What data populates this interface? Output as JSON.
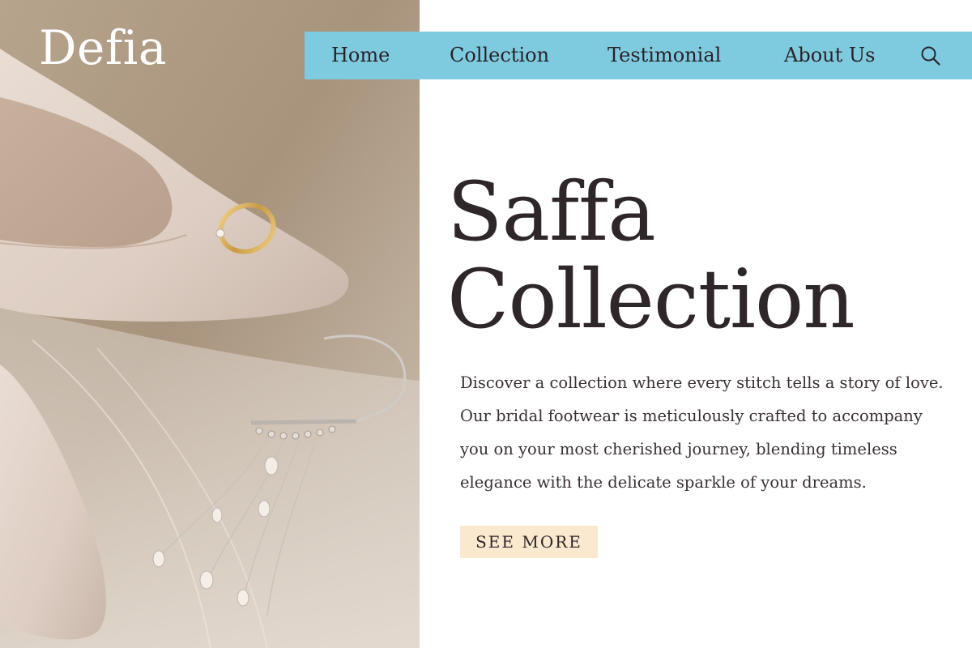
{
  "brand": {
    "logo_text": "Defia"
  },
  "nav": {
    "items": [
      {
        "label": "Home"
      },
      {
        "label": "Collection"
      },
      {
        "label": "Testimonial"
      },
      {
        "label": "About Us"
      }
    ],
    "search_icon": "search-icon",
    "bar_color": "#7ecbe0"
  },
  "hero": {
    "title_line1": "Saffa",
    "title_line2": "Collection",
    "description": "Discover a collection where every stitch tells a story of love. Our bridal footwear is meticulously crafted to accompany you on your most cherished journey, blending timeless elegance with the delicate sparkle of your dreams.",
    "cta_label": "SEE MORE",
    "cta_color": "#fbe9cf"
  },
  "image": {
    "subject": "bridal-shoe-ring-earring-photo"
  }
}
